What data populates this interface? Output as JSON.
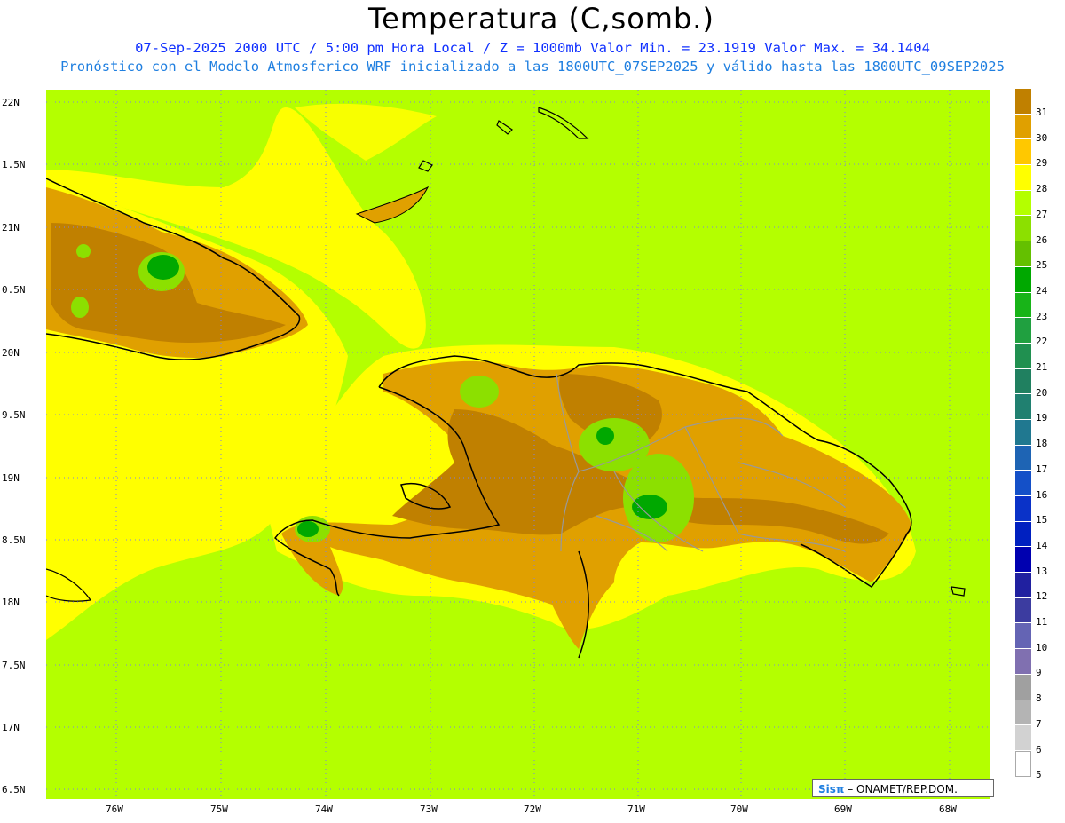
{
  "header": {
    "title": "Temperatura (C,somb.)",
    "line1": "07-Sep-2025 2000 UTC / 5:00 pm Hora Local / Z = 1000mb   Valor Min. = 23.1919  Valor Max. = 34.1404",
    "line2": "Pronóstico con el Modelo Atmosferico WRF inicializado a las 1800UTC_07SEP2025 y válido hasta las  1800UTC_09SEP2025"
  },
  "axes": {
    "lat_labels": [
      "22N",
      "1.5N",
      "21N",
      "0.5N",
      "20N",
      "9.5N",
      "19N",
      "8.5N",
      "18N",
      "7.5N",
      "17N",
      "6.5N"
    ],
    "lon_labels": [
      "76W",
      "75W",
      "74W",
      "73W",
      "72W",
      "71W",
      "70W",
      "69W",
      "68W"
    ]
  },
  "colorbar": {
    "labels": [
      "31",
      "30",
      "29",
      "28",
      "27",
      "26",
      "25",
      "24",
      "23",
      "22",
      "21",
      "20",
      "19",
      "18",
      "17",
      "16",
      "15",
      "14",
      "13",
      "12",
      "11",
      "10",
      "9",
      "8",
      "7",
      "6",
      "5"
    ],
    "colors": [
      "#c08000",
      "#e0a000",
      "#ffc800",
      "#ffff00",
      "#b4ff00",
      "#8ce000",
      "#64c000",
      "#00a800",
      "#18b418",
      "#20a040",
      "#209050",
      "#208060",
      "#208070",
      "#207890",
      "#1e64b4",
      "#1450c8",
      "#0a32c8",
      "#0020c0",
      "#0000b0",
      "#2020a0",
      "#3c3ca0",
      "#6464b4",
      "#8070b0",
      "#a0a0a0",
      "#b4b4b4",
      "#d2d2d2",
      "#ffffff"
    ]
  },
  "credit": {
    "brand": "Sisπ",
    "org": " – ONAMET/REP.DOM."
  }
}
